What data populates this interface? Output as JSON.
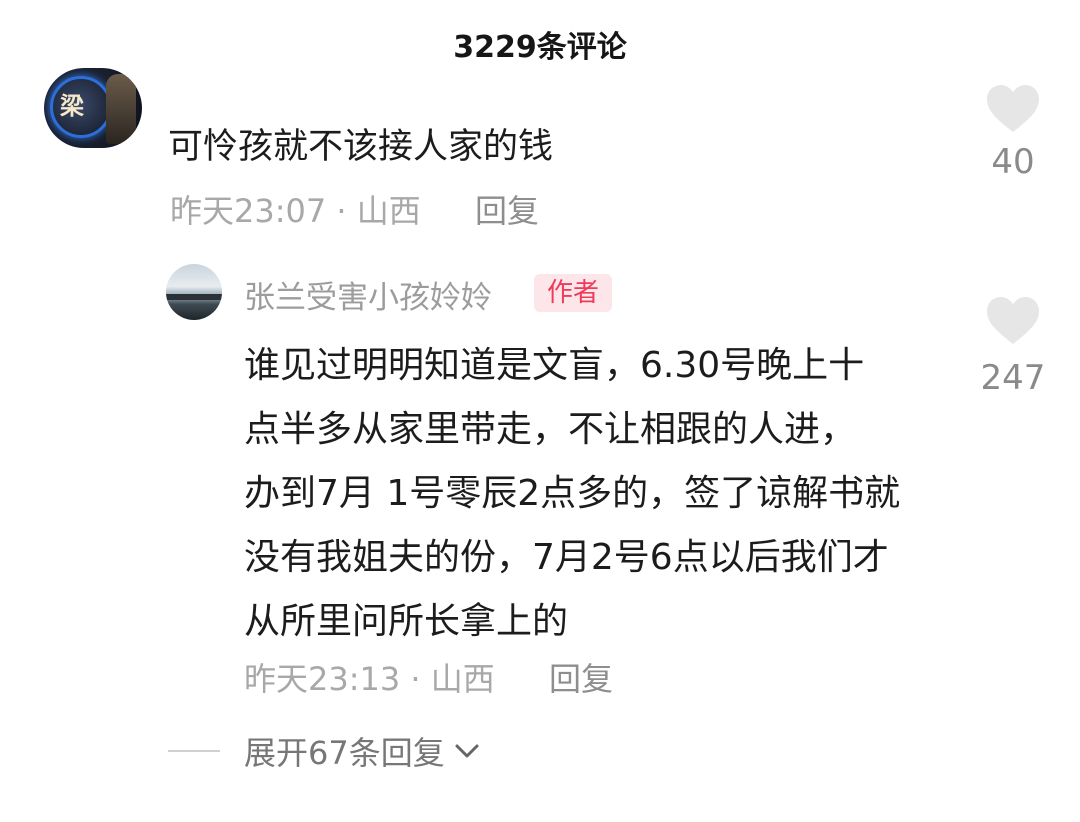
{
  "header": {
    "title": "3229条评论"
  },
  "comment1": {
    "text": "可怜孩就不该接人家的钱",
    "time": "昨天23:07",
    "location": "山西",
    "reply_label": "回复",
    "likes": "40"
  },
  "comment2": {
    "username": "张兰受害小孩姈姈",
    "badge": "作者",
    "lines": [
      "谁见过明明知道是文盲，6.30号晚上十",
      "点半多从家里带走，不让相跟的人进，",
      "办到7月 1号零辰2点多的，签了谅解书就",
      "没有我姐夫的份，7月2号6点以后我们才",
      "从所里问所长拿上的"
    ],
    "time": "昨天23:13",
    "location": "山西",
    "reply_label": "回复",
    "likes": "247"
  },
  "expand": {
    "label": "展开67条回复"
  },
  "colors": {
    "badge_bg": "#fde6e9",
    "badge_text": "#ef3b59",
    "heart": "#e6e6e6"
  }
}
